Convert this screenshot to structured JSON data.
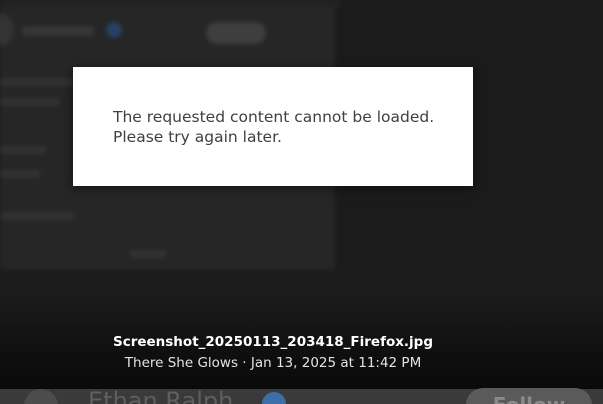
{
  "error_dialog": {
    "line1": "The requested content cannot be loaded.",
    "line2": "Please try again later."
  },
  "media_caption": {
    "filename": "Screenshot_20250113_203418_Firefox.jpg",
    "meta": "There She Glows · Jan 13, 2025 at 11:42 PM"
  },
  "profile_bar": {
    "name": "Ethan Ralph",
    "follow_label": "Follow"
  },
  "colors": {
    "backdrop": "#1b1b1b",
    "dialog_background": "#ffffff",
    "dialog_text": "#404040",
    "caption_text": "#ffffff",
    "verified_badge": "#3d6ea7"
  }
}
